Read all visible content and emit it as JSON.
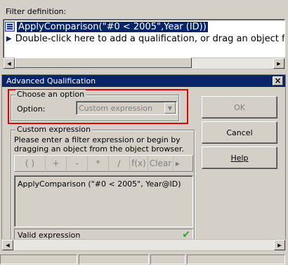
{
  "filter": {
    "title": "Filter definition:",
    "expression": "ApplyComparison(\"#0 < 2005\",Year (ID))",
    "hint": "Double-click here to add a qualification, or drag an object from the"
  },
  "dialog": {
    "title": "Advanced Qualification",
    "close_glyph": "×",
    "option_group_title": "Choose an option",
    "option_label": "Option:",
    "option_value": "Custom expression",
    "expr_group_title": "Custom expression",
    "expr_help": "Please enter a filter expression or begin by dragging an object from the object browser.",
    "toolbar": [
      "( )",
      "+",
      "-",
      "*",
      "/",
      "f(x)",
      "Clear"
    ],
    "expression_text": "ApplyComparison (\"#0 < 2005\", Year@ID)",
    "status": "Valid expression",
    "buttons": {
      "ok": "OK",
      "cancel": "Cancel",
      "help": "Help"
    }
  },
  "colors": {
    "highlight": "#e00000",
    "titlebar": "#0a246a",
    "valid": "#30a030"
  },
  "icons": {
    "check": "check-icon",
    "close": "close-icon",
    "dropdown": "chevron-down-icon"
  }
}
